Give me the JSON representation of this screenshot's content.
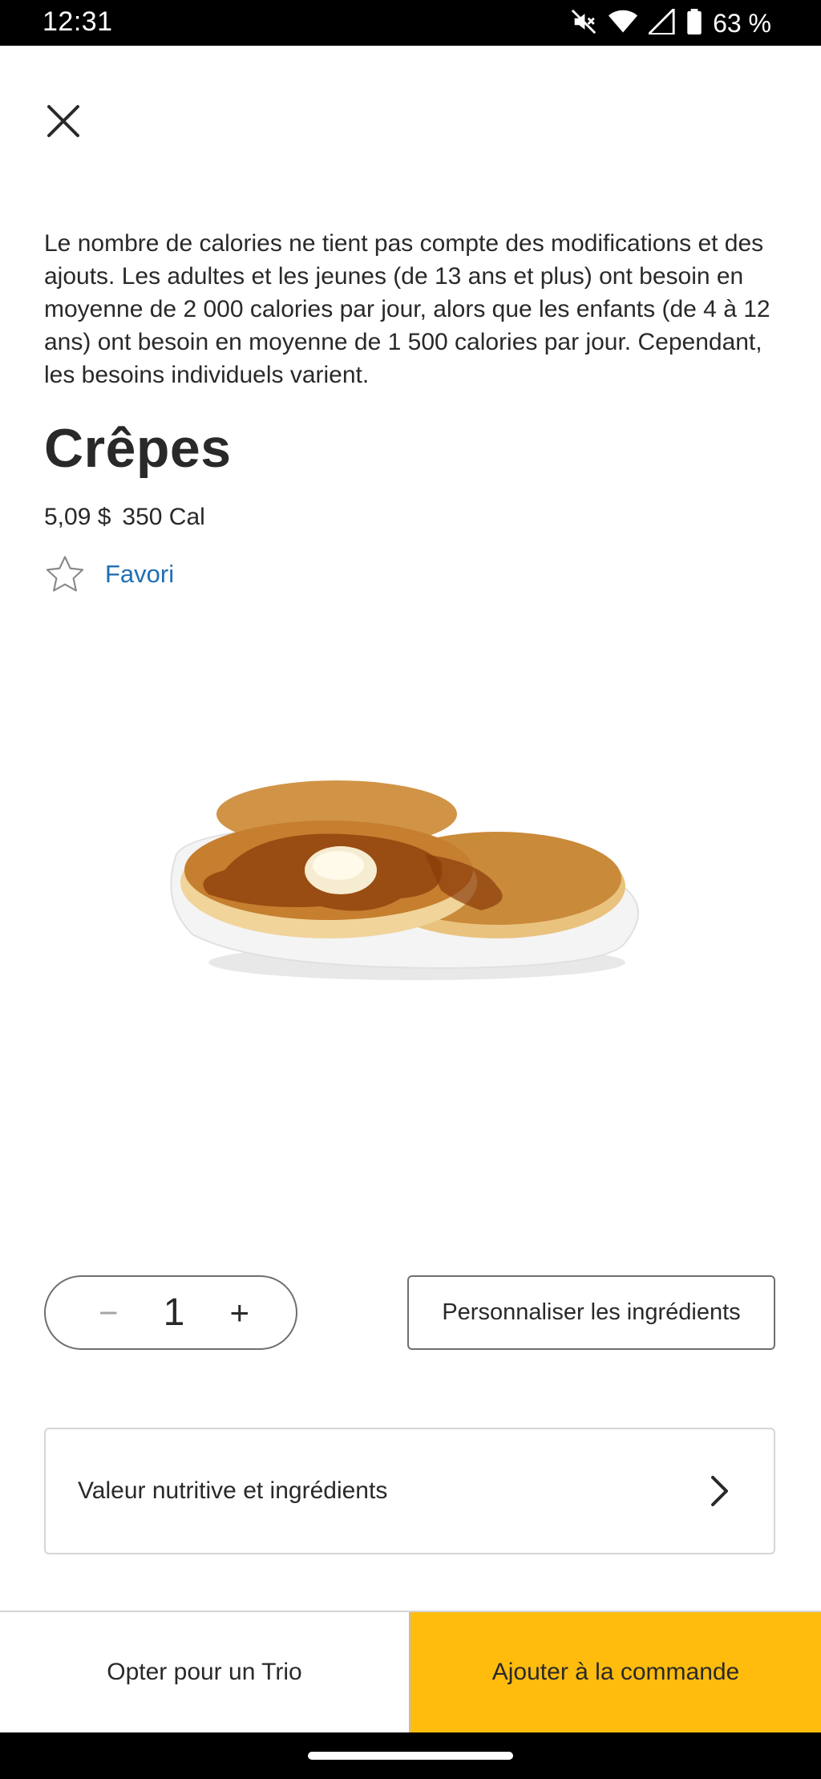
{
  "status_bar": {
    "time": "12:31",
    "battery_percent": "63 %",
    "icons": [
      "mute-icon",
      "wifi-icon",
      "signal-icon",
      "battery-icon"
    ]
  },
  "header": {
    "close_icon": "close-icon"
  },
  "disclaimer": "Le nombre de calories ne tient pas compte des modifications et des ajouts. Les adultes et les jeunes (de 13 ans et plus) ont besoin en moyenne de 2 000 calories par jour, alors que les enfants (de 4 à 12 ans) ont besoin en moyenne de 1 500 calories par jour. Cependant, les besoins individuels varient.",
  "product": {
    "name": "Crêpes",
    "price": "5,09 $",
    "calories": "350 Cal",
    "favorite_label": "Favori",
    "image_icon": "pancakes-image"
  },
  "quantity": {
    "minus": "−",
    "value": "1",
    "plus": "+"
  },
  "customize_label": "Personnaliser les ingrédients",
  "nutrition_label": "Valeur nutritive et ingrédients",
  "bottom_actions": {
    "trio_label": "Opter pour un Trio",
    "add_label": "Ajouter à la commande"
  },
  "colors": {
    "accent": "#ffbc0d",
    "link": "#1f6fb2",
    "text": "#292929"
  }
}
